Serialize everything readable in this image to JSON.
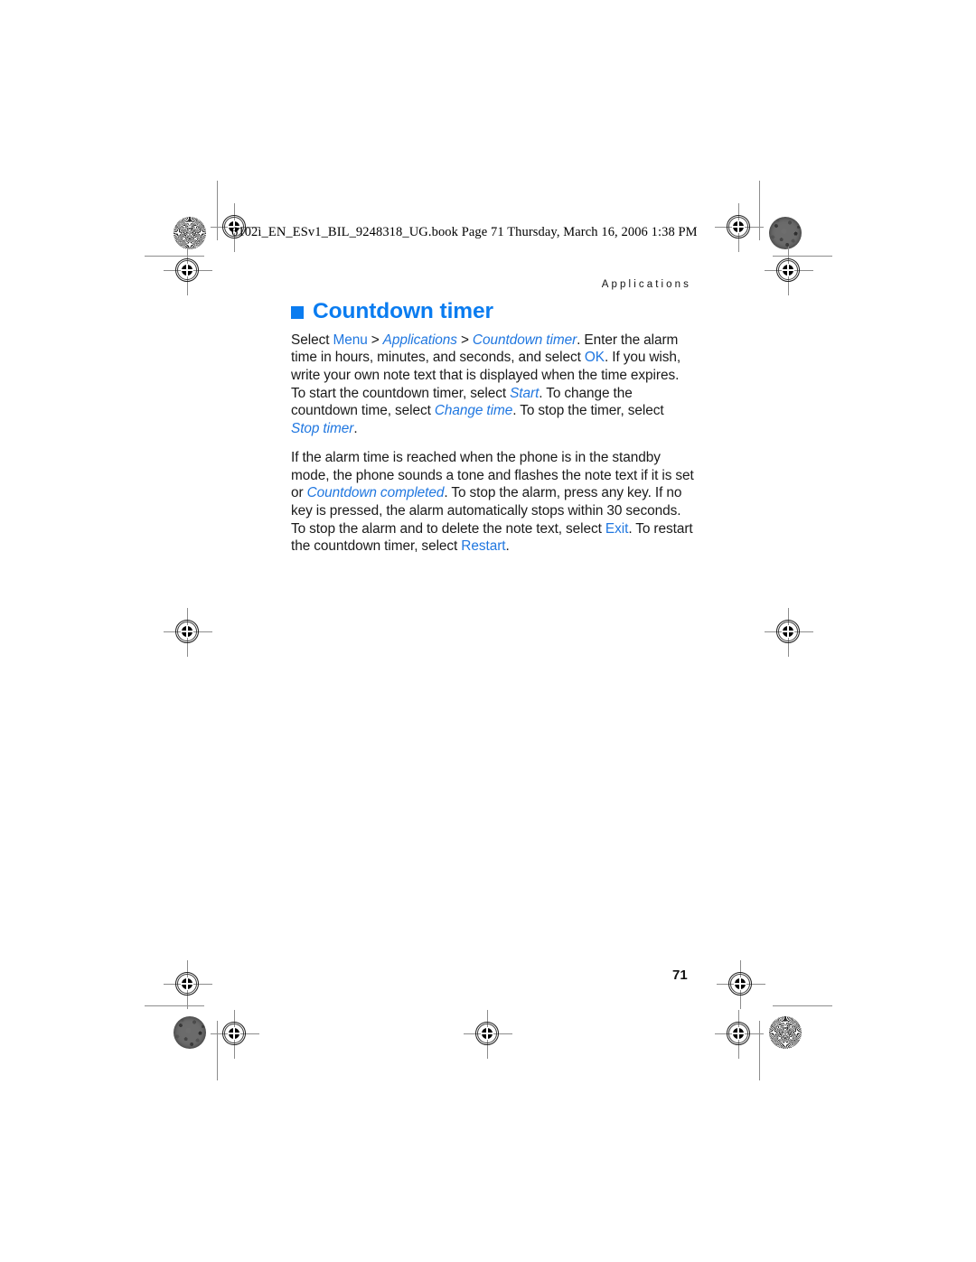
{
  "page": {
    "file_slug": "6102i_EN_ESv1_BIL_9248318_UG.book  Page 71  Thursday, March 16, 2006  1:38 PM",
    "running_head": "Applications",
    "folio": "71",
    "accent_color": "#0a7cf0",
    "link_color": "#2077e0",
    "text_color": "#1a1a1a"
  },
  "section": {
    "title": "Countdown timer",
    "bullet_icon": "blue-square-bullet"
  },
  "paragraphs": {
    "p1": {
      "s1": "Select ",
      "menu": "Menu",
      "s2": " > ",
      "applications": "Applications",
      "s3": " > ",
      "countdown_timer": "Countdown timer",
      "s4": ". Enter the alarm time in hours, minutes, and seconds, and select ",
      "ok": "OK",
      "s5": ". If you wish, write your own note text that is displayed when the time expires. To start the countdown timer, select ",
      "start": "Start",
      "s6": ". To change the countdown time, select ",
      "change_time": "Change time",
      "s7": ". To stop the timer, select ",
      "stop_timer": "Stop timer",
      "s8": "."
    },
    "p2": {
      "s1": "If the alarm time is reached when the phone is in the standby mode, the phone sounds a tone and flashes the note text if it is set or ",
      "countdown_completed": "Countdown completed",
      "s2": ". To stop the alarm, press any key. If no key is pressed, the alarm automatically stops within 30 seconds. To stop the alarm and to delete the note text, select ",
      "exit": "Exit",
      "s3": ". To restart the countdown timer, select ",
      "restart": "Restart",
      "s4": "."
    }
  }
}
